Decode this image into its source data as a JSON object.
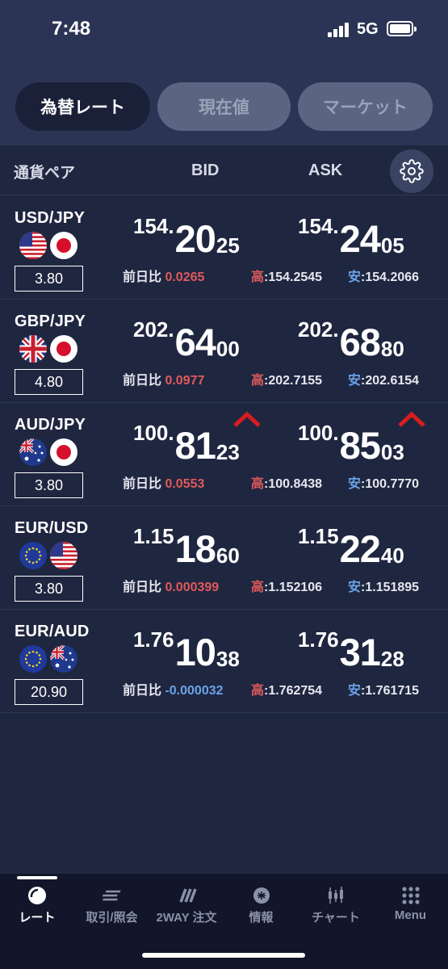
{
  "status_bar": {
    "time": "7:48",
    "network": "5G"
  },
  "tabs": [
    {
      "label": "為替レート",
      "active": true
    },
    {
      "label": "現在値",
      "active": false
    },
    {
      "label": "マーケット",
      "active": false
    }
  ],
  "header": {
    "pair_label": "通貨ペア",
    "bid_label": "BID",
    "ask_label": "ASK",
    "settings_icon": "gear-icon"
  },
  "labels": {
    "diff": "前日比 ",
    "high": "高",
    "low": "安"
  },
  "rows": [
    {
      "pair": "USD/JPY",
      "flags": [
        "us-flag-icon",
        "jp-flag-icon"
      ],
      "spread": "3.80",
      "bid": {
        "prefix": "154.",
        "main": "20",
        "suffix": "25"
      },
      "ask": {
        "prefix": "154.",
        "main": "24",
        "suffix": "05"
      },
      "up_arrow": false,
      "diff": "0.0265",
      "diff_sign": "positive",
      "high": ":154.2545",
      "low": ":154.2066"
    },
    {
      "pair": "GBP/JPY",
      "flags": [
        "uk-flag-icon",
        "jp-flag-icon"
      ],
      "spread": "4.80",
      "bid": {
        "prefix": "202.",
        "main": "64",
        "suffix": "00"
      },
      "ask": {
        "prefix": "202.",
        "main": "68",
        "suffix": "80"
      },
      "up_arrow": false,
      "diff": "0.0977",
      "diff_sign": "positive",
      "high": ":202.7155",
      "low": ":202.6154"
    },
    {
      "pair": "AUD/JPY",
      "flags": [
        "au-flag-icon",
        "jp-flag-icon"
      ],
      "spread": "3.80",
      "bid": {
        "prefix": "100.",
        "main": "81",
        "suffix": "23"
      },
      "ask": {
        "prefix": "100.",
        "main": "85",
        "suffix": "03"
      },
      "up_arrow": true,
      "diff": "0.0553",
      "diff_sign": "positive",
      "high": ":100.8438",
      "low": ":100.7770"
    },
    {
      "pair": "EUR/USD",
      "flags": [
        "eu-flag-icon",
        "us-flag-icon"
      ],
      "spread": "3.80",
      "bid": {
        "prefix": "1.15",
        "main": "18",
        "suffix": "60"
      },
      "ask": {
        "prefix": "1.15",
        "main": "22",
        "suffix": "40"
      },
      "up_arrow": false,
      "diff": "0.000399",
      "diff_sign": "positive",
      "high": ":1.152106",
      "low": ":1.151895"
    },
    {
      "pair": "EUR/AUD",
      "flags": [
        "eu-flag-icon",
        "au-flag-icon"
      ],
      "spread": "20.90",
      "bid": {
        "prefix": "1.76",
        "main": "10",
        "suffix": "38"
      },
      "ask": {
        "prefix": "1.76",
        "main": "31",
        "suffix": "28"
      },
      "up_arrow": false,
      "diff": "-0.000032",
      "diff_sign": "negative",
      "high": ":1.762754",
      "low": ":1.761715"
    }
  ],
  "colors": {
    "positive": "#e05a5a",
    "negative": "#6aa3e8",
    "up_arrow": "#d61e1e"
  },
  "bottom_nav": [
    {
      "label": "レート",
      "icon": "rate-icon",
      "active": true
    },
    {
      "label": "取引/照会",
      "icon": "trade-icon",
      "active": false
    },
    {
      "label": "2WAY 注文",
      "icon": "twoway-icon",
      "active": false
    },
    {
      "label": "情報",
      "icon": "info-icon",
      "active": false
    },
    {
      "label": "チャート",
      "icon": "chart-icon",
      "active": false
    },
    {
      "label": "Menu",
      "icon": "menu-grid-icon",
      "active": false
    }
  ]
}
